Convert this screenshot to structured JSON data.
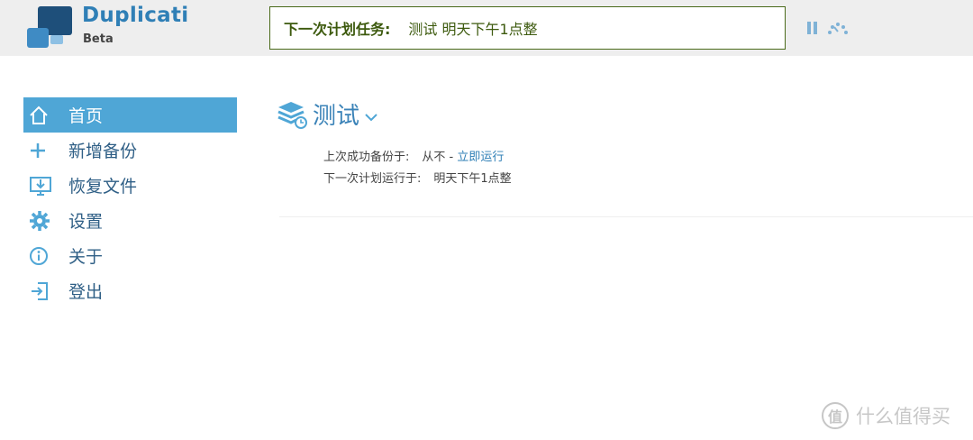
{
  "brand": {
    "name": "Duplicati",
    "sub": "Beta"
  },
  "header": {
    "next_task_label": "下一次计划任务:",
    "next_task_value": "测试 明天下午1点整"
  },
  "sidebar": {
    "items": [
      {
        "label": "首页",
        "icon": "home-icon",
        "active": true
      },
      {
        "label": "新增备份",
        "icon": "plus-icon",
        "active": false
      },
      {
        "label": "恢复文件",
        "icon": "restore-icon",
        "active": false
      },
      {
        "label": "设置",
        "icon": "gear-icon",
        "active": false
      },
      {
        "label": "关于",
        "icon": "info-icon",
        "active": false
      },
      {
        "label": "登出",
        "icon": "logout-icon",
        "active": false
      }
    ]
  },
  "main": {
    "backup_name": "测试",
    "last_success_label": "上次成功备份于:",
    "last_success_value": "从不 - ",
    "run_now_label": "立即运行",
    "next_run_label": "下一次计划运行于:",
    "next_run_value": "明天下午1点整"
  },
  "watermark": {
    "glyph": "值",
    "text": "什么值得买"
  },
  "colors": {
    "accent": "#4fa6d6",
    "brand": "#2f7fb6",
    "task_text": "#3d5a0e",
    "header_bg": "#eeeeee"
  }
}
